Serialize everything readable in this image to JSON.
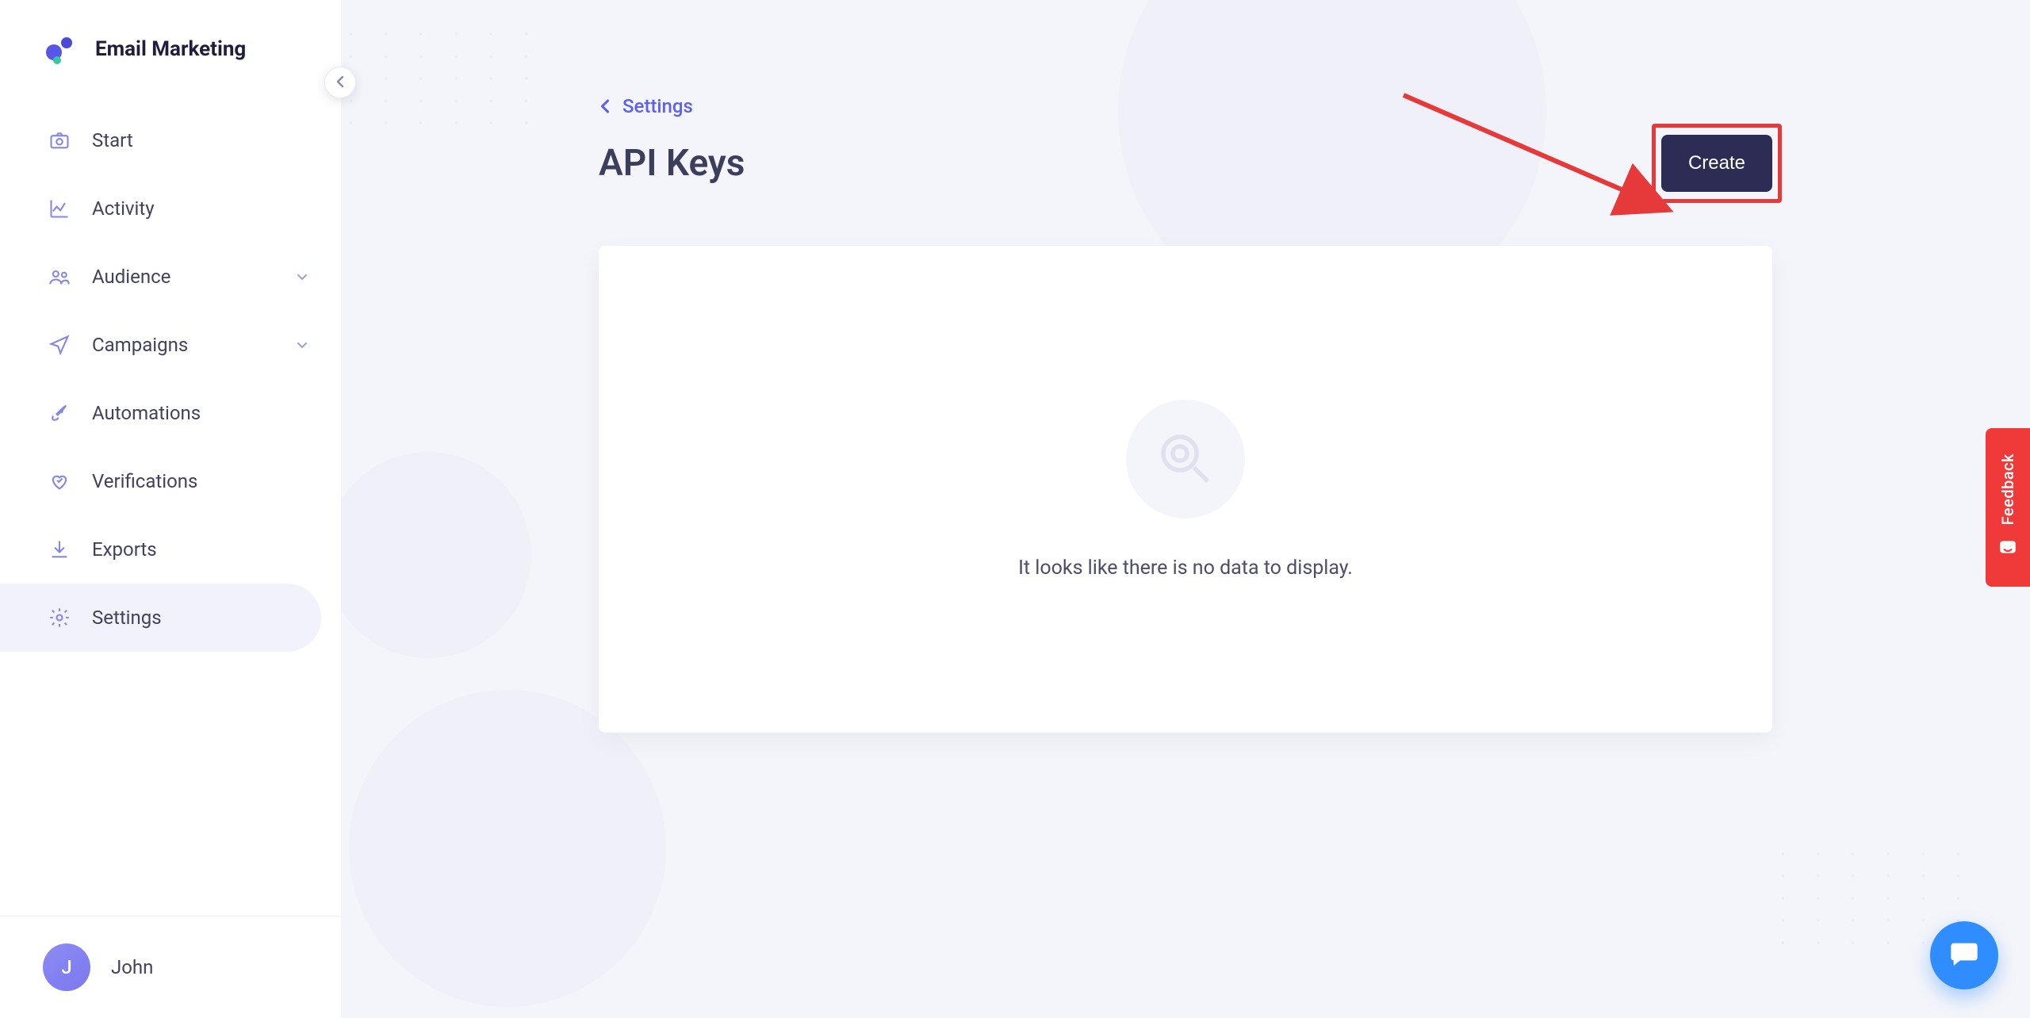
{
  "app": {
    "name": "Email Marketing"
  },
  "sidebar": {
    "items": [
      {
        "label": "Start"
      },
      {
        "label": "Activity"
      },
      {
        "label": "Audience"
      },
      {
        "label": "Campaigns"
      },
      {
        "label": "Automations"
      },
      {
        "label": "Verifications"
      },
      {
        "label": "Exports"
      },
      {
        "label": "Settings"
      }
    ]
  },
  "user": {
    "initial": "J",
    "name": "John"
  },
  "breadcrumb": {
    "label": "Settings"
  },
  "page": {
    "title": "API Keys",
    "create_label": "Create",
    "empty_message": "It looks like there is no data to display."
  },
  "feedback": {
    "label": "Feedback"
  }
}
